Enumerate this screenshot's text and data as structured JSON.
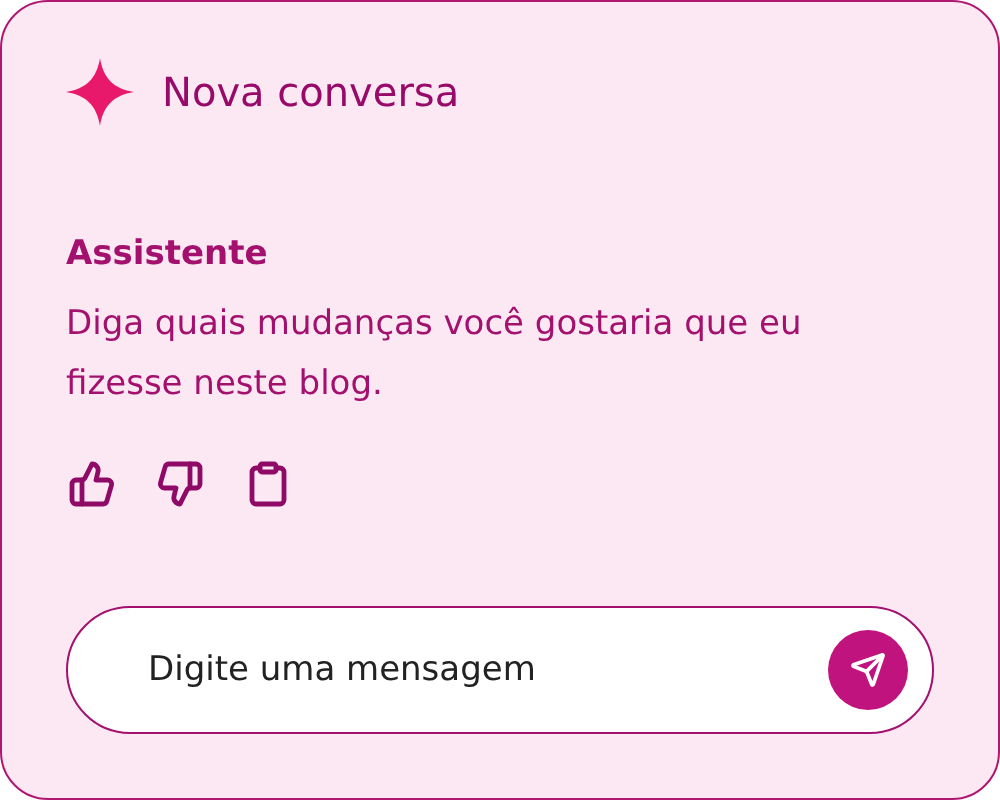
{
  "header": {
    "title": "Nova conversa"
  },
  "message": {
    "author": "Assistente",
    "text": "Diga quais mudanças você gostaria que eu fizesse neste blog."
  },
  "composer": {
    "placeholder": "Digite uma mensagem"
  }
}
